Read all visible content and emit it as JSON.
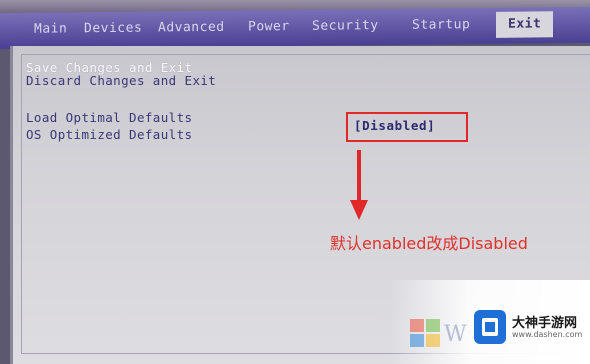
{
  "menu": {
    "tabs": [
      {
        "label": "Main"
      },
      {
        "label": "Devices"
      },
      {
        "label": "Advanced"
      },
      {
        "label": "Power"
      },
      {
        "label": "Security"
      },
      {
        "label": "Startup"
      },
      {
        "label": "Exit"
      }
    ],
    "active": "Exit"
  },
  "exit_menu": {
    "items": [
      {
        "label": "Save Changes and Exit"
      },
      {
        "label": "Discard Changes and Exit"
      },
      {
        "label": "Load Optimal Defaults"
      },
      {
        "label": "OS Optimized Defaults"
      }
    ],
    "selected": "Save Changes and Exit",
    "os_optimized_value": "[Disabled]"
  },
  "annotation": {
    "text": "默认enabled改成Disabled",
    "color": "#e0322b"
  },
  "watermark": {
    "brand": "大神手游网",
    "url": "www.dashen.com",
    "logo_letter": "W"
  },
  "colors": {
    "menubar": "#4b3f92",
    "highlight_box": "#e12828",
    "item_text": "#3b3778"
  }
}
